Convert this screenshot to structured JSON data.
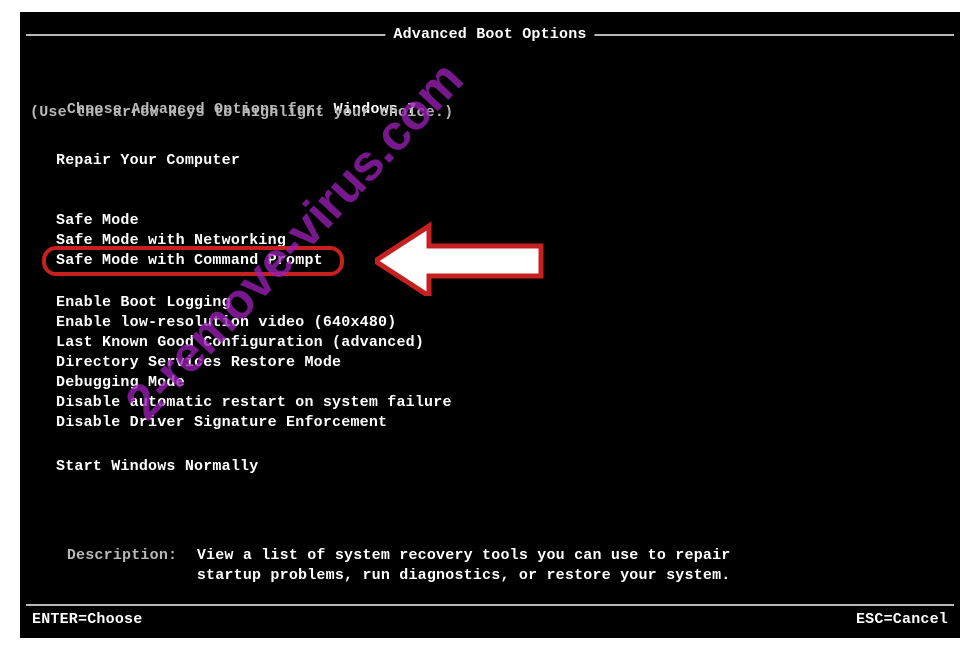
{
  "title": "Advanced Boot Options",
  "prompt_prefix": "Choose Advanced Options for: ",
  "os_name": "Windows 7",
  "hint": "(Use the arrow keys to highlight your choice.)",
  "groups": {
    "repair": [
      "Repair Your Computer"
    ],
    "safe": [
      "Safe Mode",
      "Safe Mode with Networking",
      "Safe Mode with Command Prompt"
    ],
    "advanced": [
      "Enable Boot Logging",
      "Enable low-resolution video (640x480)",
      "Last Known Good Configuration (advanced)",
      "Directory Services Restore Mode",
      "Debugging Mode",
      "Disable automatic restart on system failure",
      "Disable Driver Signature Enforcement"
    ],
    "normal": [
      "Start Windows Normally"
    ]
  },
  "highlighted_index": {
    "group": "safe",
    "i": 2
  },
  "description_label": "Description:",
  "description_text_line1": "View a list of system recovery tools you can use to repair",
  "description_text_line2": "startup problems, run diagnostics, or restore your system.",
  "footer": {
    "left": "ENTER=Choose",
    "right": "ESC=Cancel"
  },
  "watermark": "2-remove-virus.com",
  "annotation": {
    "arrow_color": "#ffffff",
    "arrow_outline": "#c62020"
  }
}
